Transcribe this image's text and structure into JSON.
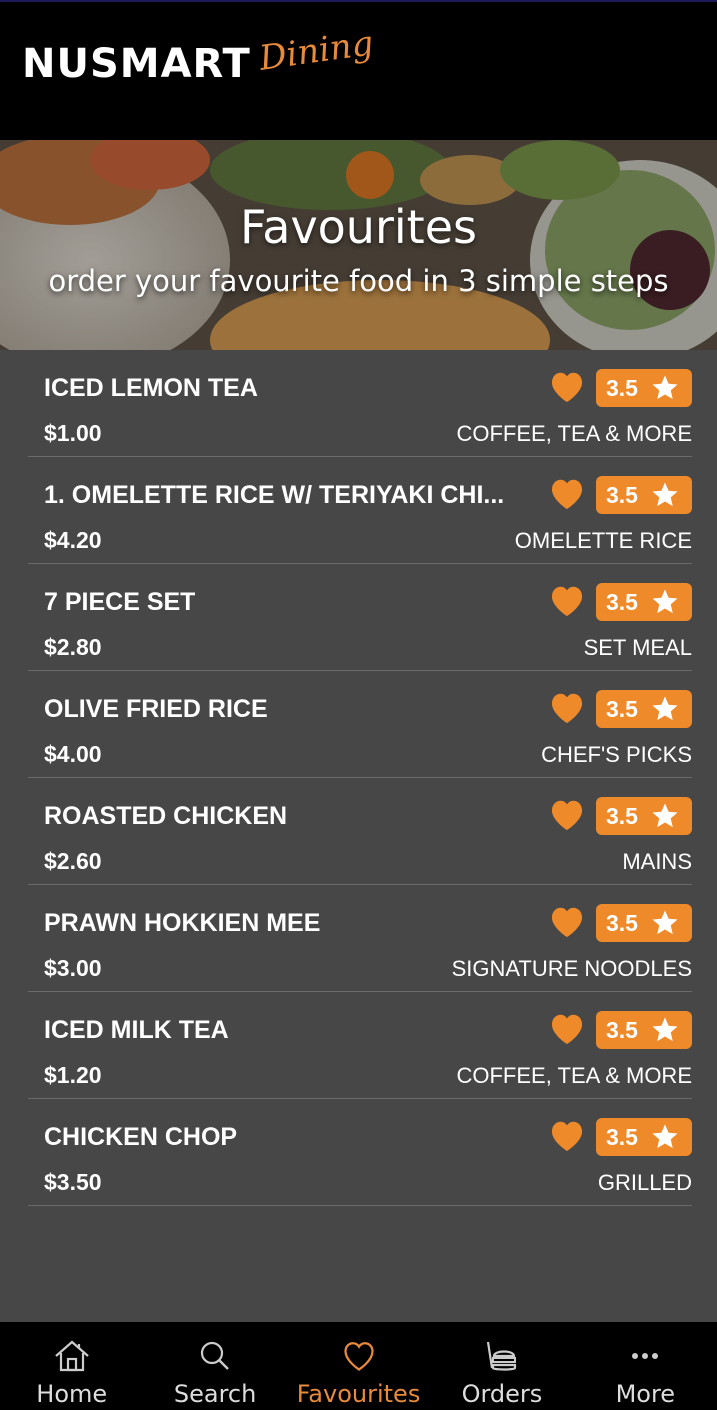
{
  "app": {
    "logo_main": "NUSMART",
    "logo_script": "Dining"
  },
  "hero": {
    "title": "Favourites",
    "subtitle": "order your favourite food in 3 simple steps"
  },
  "favourites": [
    {
      "name": "ICED LEMON TEA",
      "price": "$1.00",
      "category": "COFFEE, TEA & MORE",
      "rating": "3.5"
    },
    {
      "name": "1. OMELETTE RICE W/ TERIYAKI CHI...",
      "price": "$4.20",
      "category": "OMELETTE RICE",
      "rating": "3.5"
    },
    {
      "name": "7 PIECE SET",
      "price": "$2.80",
      "category": "SET MEAL",
      "rating": "3.5"
    },
    {
      "name": "OLIVE FRIED RICE",
      "price": "$4.00",
      "category": "CHEF'S PICKS",
      "rating": "3.5"
    },
    {
      "name": "ROASTED CHICKEN",
      "price": "$2.60",
      "category": "MAINS",
      "rating": "3.5"
    },
    {
      "name": "PRAWN HOKKIEN MEE",
      "price": "$3.00",
      "category": "SIGNATURE NOODLES",
      "rating": "3.5"
    },
    {
      "name": "ICED MILK TEA",
      "price": "$1.20",
      "category": "COFFEE, TEA & MORE",
      "rating": "3.5"
    },
    {
      "name": "CHICKEN CHOP",
      "price": "$3.50",
      "category": "GRILLED",
      "rating": "3.5"
    }
  ],
  "nav": {
    "home": "Home",
    "search": "Search",
    "favourites": "Favourites",
    "orders": "Orders",
    "more": "More",
    "active": "favourites"
  },
  "colors": {
    "accent": "#ef8a2b",
    "background": "#474747",
    "bar": "#000000"
  }
}
